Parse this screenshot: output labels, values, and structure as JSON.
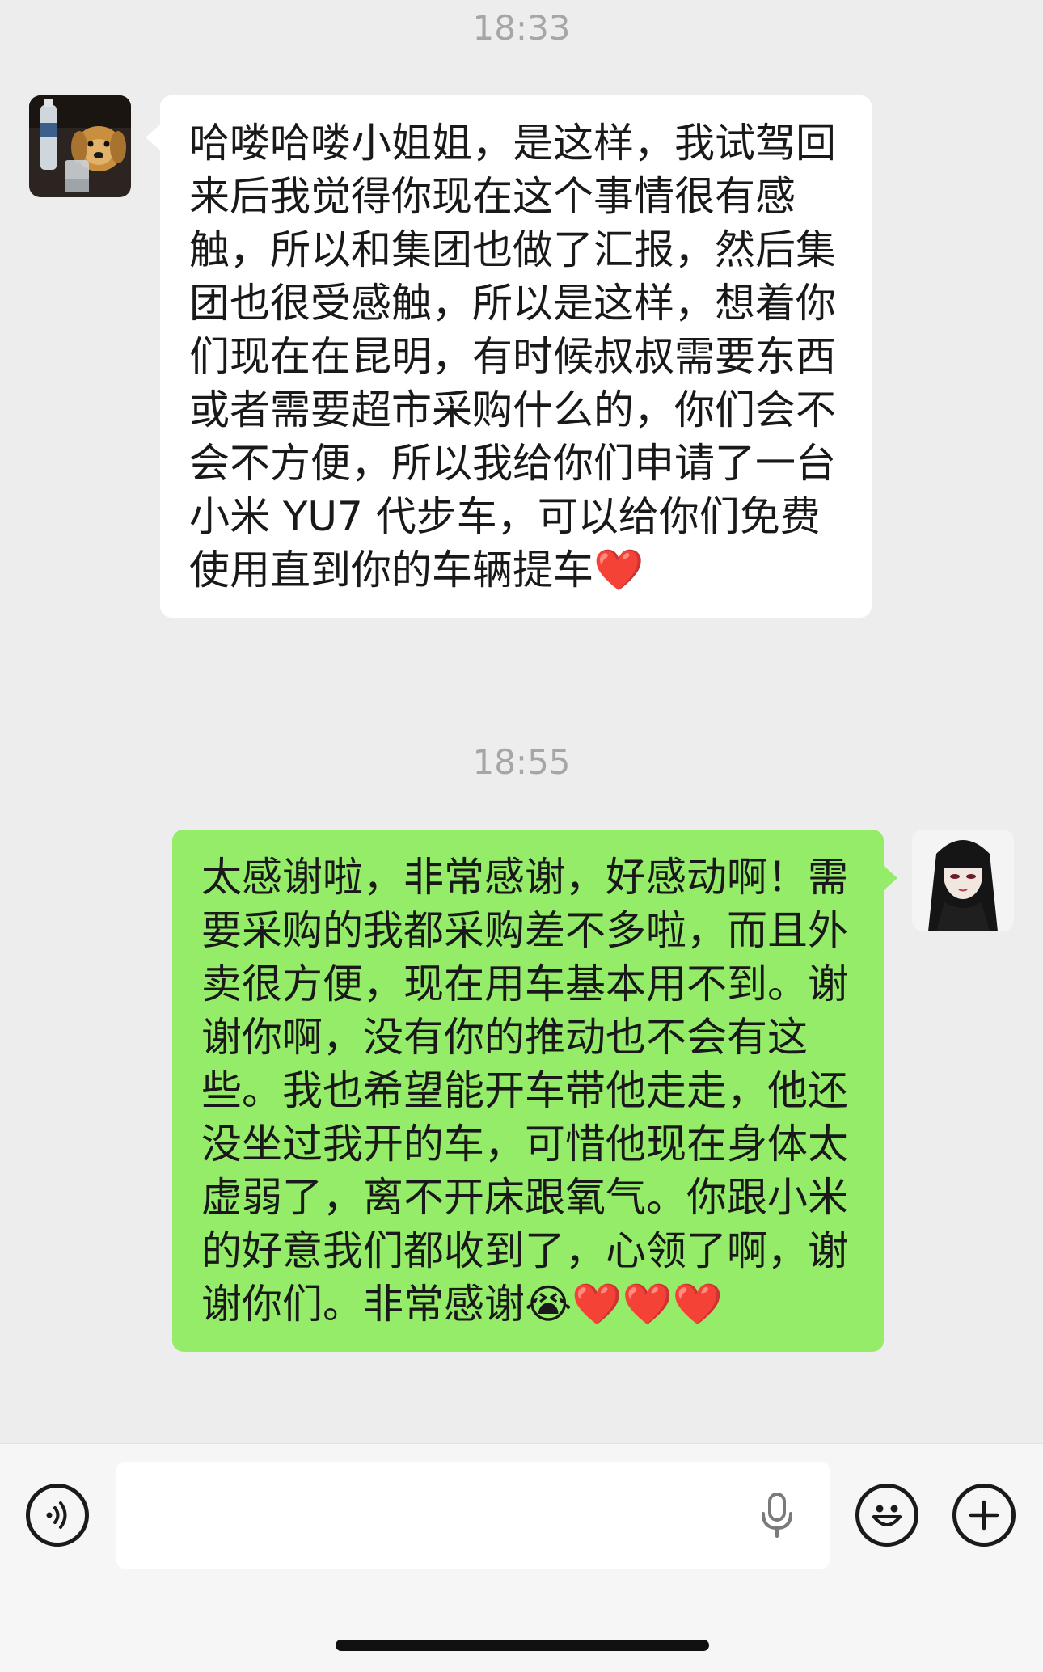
{
  "messages": [
    {
      "time": "18:33",
      "direction": "incoming",
      "text": "哈喽哈喽小姐姐，是这样，我试驾回来后我觉得你现在这个事情很有感触，所以和集团也做了汇报，然后集团也很受感触，所以是这样，想着你们现在在昆明，有时候叔叔需要东西或者需要超市采购什么的，你们会不会不方便，所以我给你们申请了一台小米 YU7 代步车，可以给你们免费使用直到你的车辆提车❤️"
    },
    {
      "time": "18:55",
      "direction": "outgoing",
      "text": "太感谢啦，非常感谢，好感动啊！需要采购的我都采购差不多啦，而且外卖很方便，现在用车基本用不到。谢谢你啊，没有你的推动也不会有这些。我也希望能开车带他走走，他还没坐过我开的车，可惜他现在身体太虚弱了，离不开床跟氧气。你跟小米的好意我们都收到了，心领了啊，谢谢你们。非常感谢😭❤️❤️❤️"
    }
  ],
  "input": {
    "value": "",
    "placeholder": ""
  },
  "icons": {
    "voice": "voice-mode-icon",
    "mic": "microphone-icon",
    "emoji": "emoji-icon",
    "plus": "plus-icon"
  },
  "colors": {
    "background": "#ededed",
    "incoming_bubble": "#ffffff",
    "outgoing_bubble": "#95ec69",
    "timestamp": "#a6a6a6"
  }
}
